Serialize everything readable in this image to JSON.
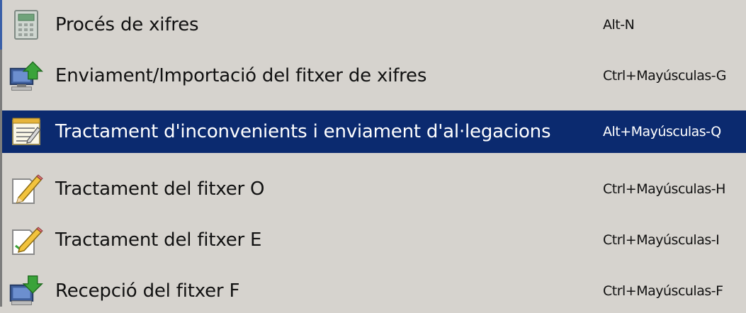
{
  "menu": {
    "items": [
      {
        "label": "Procés de xifres",
        "shortcut": "Alt-N",
        "icon": "calculator-icon"
      },
      {
        "label": "Enviament/Importació del fitxer de xifres",
        "shortcut": "Ctrl+Mayúsculas-G",
        "icon": "upload-computer-icon"
      },
      {
        "label": "Tractament d'inconvenients i enviament d'al·legacions",
        "shortcut": "Alt+Mayúsculas-Q",
        "icon": "notepad-icon",
        "selected": true
      },
      {
        "label": "Tractament del fitxer O",
        "shortcut": "Ctrl+Mayúsculas-H",
        "icon": "pencil-document-icon"
      },
      {
        "label": "Tractament del fitxer E",
        "shortcut": "Ctrl+Mayúsculas-I",
        "icon": "edit-document-icon"
      },
      {
        "label": "Recepció del fitxer F",
        "shortcut": "Ctrl+Mayúsculas-F",
        "icon": "download-computer-icon"
      }
    ]
  },
  "colors": {
    "menu_background": "#d6d3ce",
    "selection": "#0b2a6f",
    "selected_text": "#ffffff",
    "text": "#111111"
  }
}
